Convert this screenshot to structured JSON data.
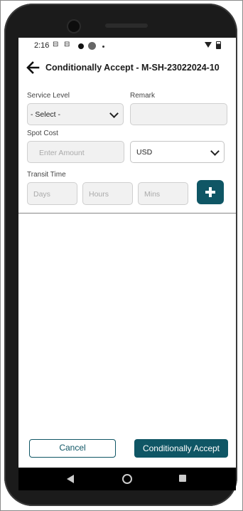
{
  "status_bar": {
    "time": "2:16",
    "icons": [
      "sim-icon",
      "sim-icon",
      "notification-dot-icon",
      "record-icon",
      "more-dot-icon",
      "wifi-icon",
      "battery-icon"
    ]
  },
  "header": {
    "back_icon": "arrow-left-icon",
    "title": "Conditionally Accept - M-SH-23022024-10"
  },
  "form": {
    "service_level": {
      "label": "Service Level",
      "value": "- Select -"
    },
    "remark": {
      "label": "Remark",
      "value": ""
    },
    "spot_cost": {
      "label": "Spot Cost",
      "required_mark": "*",
      "placeholder": "Enter Amount",
      "value": ""
    },
    "currency": {
      "value": "USD"
    },
    "transit_time": {
      "label": "Transit Time",
      "days_placeholder": "Days",
      "hours_placeholder": "Hours",
      "mins_placeholder": "Mins"
    },
    "add_button_icon": "plus-icon"
  },
  "footer": {
    "cancel_label": "Cancel",
    "accept_label": "Conditionally Accept"
  },
  "colors": {
    "primary": "#0f5665",
    "required": "#d32f2f",
    "field_bg": "#f1f1f1"
  }
}
